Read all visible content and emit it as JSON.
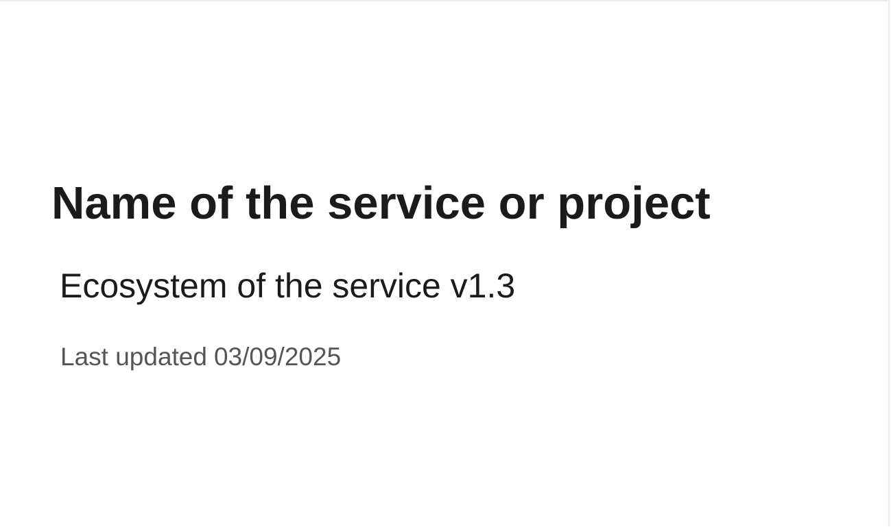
{
  "slide": {
    "title": "Name of the service or project",
    "subtitle": "Ecosystem of the service v1.3",
    "updated_label": "Last updated",
    "updated_date": "03/09/2025"
  },
  "colors": {
    "background": "#ffffff",
    "title_text": "#1b1b1b",
    "subtitle_text": "#1b1b1b",
    "meta_text": "#555555"
  }
}
